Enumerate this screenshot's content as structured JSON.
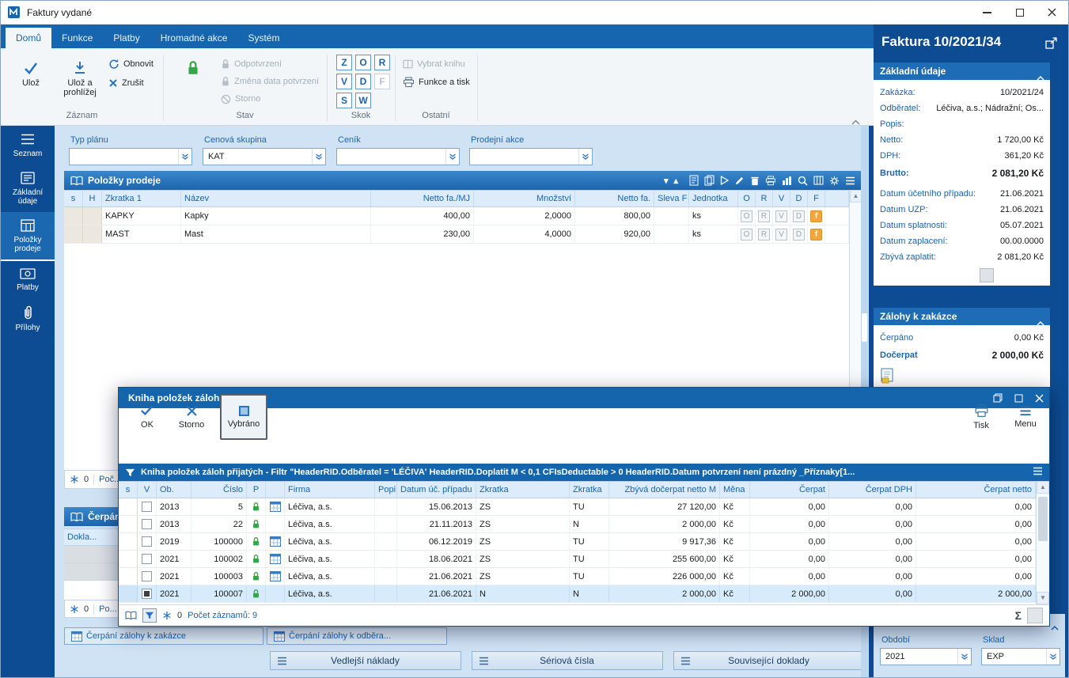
{
  "window": {
    "title": "Faktury vydané"
  },
  "ribbon": {
    "tabs": [
      "Domů",
      "Funkce",
      "Platby",
      "Hromadné akce",
      "Systém"
    ],
    "groups": [
      "Záznam",
      "Stav",
      "Skok",
      "Ostatní"
    ],
    "buttons": {
      "ulozit": "Ulož",
      "ulozit_prohlizej": "Ulož a prohlížej",
      "obnovit": "Obnovit",
      "zrusit": "Zrušit",
      "potvrzeni": "Potvrzení",
      "odpotvrzeni": "Odpotvrzení",
      "zmena_data": "Změna data potvrzení",
      "storno": "Storno",
      "vybrat_knihu": "Vybrat knihu",
      "funkce_tisk": "Funkce a tisk"
    },
    "skok": [
      "Z",
      "O",
      "R",
      "V",
      "D",
      "F",
      "S",
      "W"
    ]
  },
  "sidebar": {
    "items": [
      "Seznam",
      "Základní údaje",
      "Položky prodeje",
      "Platby",
      "Přílohy"
    ]
  },
  "filters": [
    {
      "label": "Typ plánu",
      "value": ""
    },
    {
      "label": "Cenová skupina",
      "value": "KAT"
    },
    {
      "label": "Ceník",
      "value": ""
    },
    {
      "label": "Prodejní akce",
      "value": ""
    }
  ],
  "items_panel": {
    "title": "Položky prodeje",
    "columns": [
      "s",
      "H",
      "Zkratka 1",
      "Název",
      "Netto fa./MJ",
      "Množství",
      "Netto fa.",
      "Sleva F",
      "Jednotka",
      "O",
      "R",
      "V",
      "D",
      "F"
    ],
    "rows": [
      {
        "zkratka": "KAPKY",
        "nazev": "Kapky",
        "netto_mj": "400,00",
        "mnozstvi": "2,0000",
        "netto": "800,00",
        "sleva": "",
        "jednotka": "ks",
        "o": "O",
        "r": "R",
        "v": "V",
        "d": "D",
        "f": "f"
      },
      {
        "zkratka": "MAST",
        "nazev": "Mast",
        "netto_mj": "230,00",
        "mnozstvi": "4,0000",
        "netto": "920,00",
        "sleva": "",
        "jednotka": "ks",
        "o": "O",
        "r": "R",
        "v": "V",
        "d": "D",
        "f": "f"
      }
    ],
    "status": {
      "frozen": "0",
      "count": "Poč..."
    }
  },
  "cerpani_panel": {
    "title": "Čerpání zál...",
    "column": "Dokla...",
    "status": {
      "frozen": "0",
      "count": "Po..."
    },
    "tabs": [
      "Čerpání zálohy k zakázce",
      "Čerpání zálohy k odběra..."
    ]
  },
  "bottom_buttons": [
    "Vedlejší náklady",
    "Sériová čísla",
    "Související doklady"
  ],
  "modal": {
    "title": "Kniha položek záloh přijatých",
    "toolbar": {
      "ok": "OK",
      "storno": "Storno",
      "vybrano": "Vybráno",
      "tisk": "Tisk",
      "menu": "Menu"
    },
    "filter_text": "Kniha položek záloh přijatých - Filtr \"HeaderRID.Odběratel = 'LÉČIVA'  HeaderRID.Doplatit M < 0,1  CFIsDeductable > 0  HeaderRID.Datum potvrzení není prázdný  _Příznaky[1...",
    "columns": [
      "s",
      "V",
      "Ob.",
      "Číslo",
      "P",
      "",
      "Firma",
      "Popi",
      "Datum úč. případu",
      "Zkratka",
      "Zkratka",
      "Zbývá dočerpat netto M",
      "Měna",
      "Čerpat",
      "Čerpat DPH",
      "Čerpat netto"
    ],
    "rows": [
      {
        "ob": "2013",
        "cislo": "5",
        "popis": "",
        "firma": "Léčiva, a.s.",
        "datum": "15.06.2013",
        "zk1": "ZS",
        "zk2": "TU",
        "zbyva": "27 120,00",
        "mena": "Kč",
        "cerpat": "0,00",
        "dph": "0,00",
        "netto": "0,00",
        "doc": true,
        "checked": false,
        "selected": false
      },
      {
        "ob": "2013",
        "cislo": "22",
        "popis": "",
        "firma": "Léčiva, a.s.",
        "datum": "21.11.2013",
        "zk1": "ZS",
        "zk2": "N",
        "zbyva": "2 000,00",
        "mena": "Kč",
        "cerpat": "0,00",
        "dph": "0,00",
        "netto": "0,00",
        "doc": false,
        "checked": false,
        "selected": false
      },
      {
        "ob": "2019",
        "cislo": "100000",
        "popis": "",
        "firma": "Léčiva, a.s.",
        "datum": "06.12.2019",
        "zk1": "ZS",
        "zk2": "TU",
        "zbyva": "9 917,36",
        "mena": "Kč",
        "cerpat": "0,00",
        "dph": "0,00",
        "netto": "0,00",
        "doc": true,
        "checked": false,
        "selected": false
      },
      {
        "ob": "2021",
        "cislo": "100002",
        "popis": "",
        "firma": "Léčiva, a.s.",
        "datum": "18.06.2021",
        "zk1": "ZS",
        "zk2": "TU",
        "zbyva": "255 600,00",
        "mena": "Kč",
        "cerpat": "0,00",
        "dph": "0,00",
        "netto": "0,00",
        "doc": true,
        "checked": false,
        "selected": false
      },
      {
        "ob": "2021",
        "cislo": "100003",
        "popis": "",
        "firma": "Léčiva, a.s.",
        "datum": "21.06.2021",
        "zk1": "ZS",
        "zk2": "TU",
        "zbyva": "226 000,00",
        "mena": "Kč",
        "cerpat": "0,00",
        "dph": "0,00",
        "netto": "0,00",
        "doc": true,
        "checked": false,
        "selected": false
      },
      {
        "ob": "2021",
        "cislo": "100007",
        "popis": "",
        "firma": "Léčiva, a.s.",
        "datum": "21.06.2021",
        "zk1": "N",
        "zk2": "N",
        "zbyva": "2 000,00",
        "mena": "Kč",
        "cerpat": "2 000,00",
        "dph": "0,00",
        "netto": "2 000,00",
        "doc": false,
        "checked": true,
        "selected": true
      }
    ],
    "status": {
      "frozen": "0",
      "count": "Počet záznamů: 9",
      "sum": "Σ"
    }
  },
  "invoice_panel": {
    "title": "Faktura 10/2021/34",
    "zakladni": {
      "title": "Základní údaje",
      "fields": [
        {
          "label": "Zakázka:",
          "value": "10/2021/24"
        },
        {
          "label": "Odběratel:",
          "value": "Léčiva, a.s.; Nádražní; Os..."
        },
        {
          "label": "Popis:",
          "value": ""
        },
        {
          "label": "Netto:",
          "value": "1 720,00 Kč"
        },
        {
          "label": "DPH:",
          "value": "361,20 Kč"
        },
        {
          "label": "Brutto:",
          "value": "2 081,20 Kč"
        },
        {
          "label": "Datum účetního případu:",
          "value": "21.06.2021"
        },
        {
          "label": "Datum UZP:",
          "value": "21.06.2021"
        },
        {
          "label": "Datum splatnosti:",
          "value": "05.07.2021"
        },
        {
          "label": "Datum zaplacení:",
          "value": "00.00.0000"
        },
        {
          "label": "Zbývá zaplatit:",
          "value": "2 081,20 Kč"
        }
      ]
    },
    "zalohy": {
      "title": "Zálohy k zakázce",
      "fields": [
        {
          "label": "Čerpáno",
          "value": "0,00 Kč"
        },
        {
          "label": "Dočerpat",
          "value": "2 000,00 Kč"
        }
      ]
    },
    "footer": {
      "obdobi_label": "Období",
      "obdobi_value": "2021",
      "sklad_label": "Sklad",
      "sklad_value": "EXP"
    }
  }
}
